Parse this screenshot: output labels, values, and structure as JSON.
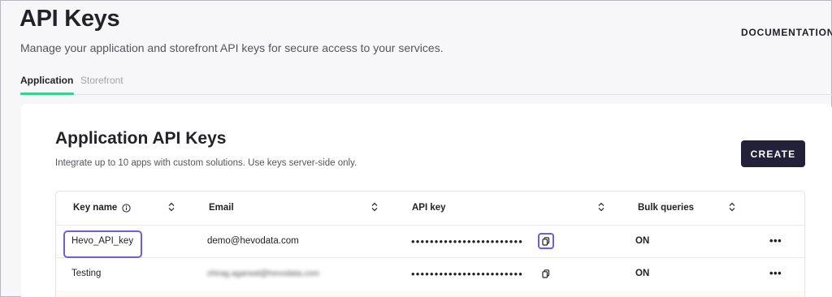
{
  "header": {
    "title": "API Keys",
    "subtitle": "Manage your application and storefront API keys for secure access to your services.",
    "documentation_label": "DOCUMENTATION"
  },
  "tabs": [
    {
      "label": "Application",
      "active": true
    },
    {
      "label": "Storefront",
      "active": false
    }
  ],
  "section": {
    "title": "Application API Keys",
    "description": "Integrate up to 10 apps with custom solutions. Use keys server-side only.",
    "create_label": "CREATE"
  },
  "table": {
    "columns": [
      "Key name",
      "Email",
      "API key",
      "Bulk queries"
    ],
    "rows": [
      {
        "key_name": "Hevo_API_key",
        "email": "demo@hevodata.com",
        "api_key": "••••••••••••••••••••••••",
        "bulk_queries": "ON",
        "more": "•••"
      },
      {
        "key_name": "Testing",
        "email": "chirag.agarwal@hevodata.com",
        "api_key": "••••••••••••••••••••••••",
        "bulk_queries": "ON",
        "more": "•••"
      }
    ]
  },
  "colors": {
    "accent_tab": "#3ad08c",
    "button_bg": "#23213a",
    "highlight": "#6d5fd6"
  },
  "icons": [
    "info-icon",
    "sort-icon",
    "copy-icon",
    "more-icon"
  ]
}
